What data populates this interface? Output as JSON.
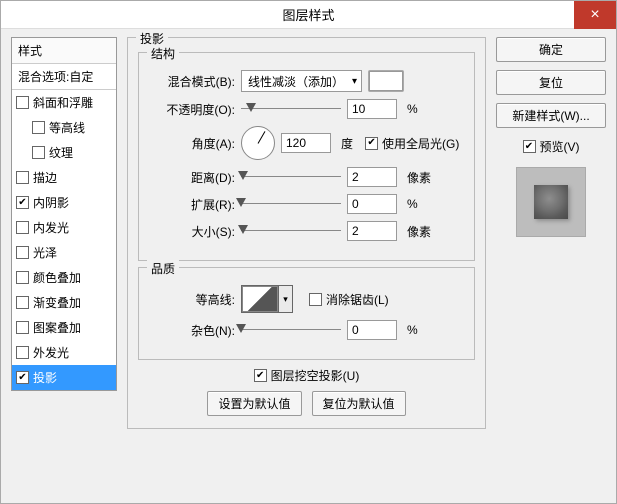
{
  "title": "图层样式",
  "left": {
    "header": "样式",
    "blending": "混合选项:自定",
    "items": [
      {
        "label": "斜面和浮雕",
        "checked": false,
        "indent": false
      },
      {
        "label": "等高线",
        "checked": false,
        "indent": true
      },
      {
        "label": "纹理",
        "checked": false,
        "indent": true
      },
      {
        "label": "描边",
        "checked": false,
        "indent": false
      },
      {
        "label": "内阴影",
        "checked": true,
        "indent": false
      },
      {
        "label": "内发光",
        "checked": false,
        "indent": false
      },
      {
        "label": "光泽",
        "checked": false,
        "indent": false
      },
      {
        "label": "颜色叠加",
        "checked": false,
        "indent": false
      },
      {
        "label": "渐变叠加",
        "checked": false,
        "indent": false
      },
      {
        "label": "图案叠加",
        "checked": false,
        "indent": false
      },
      {
        "label": "外发光",
        "checked": false,
        "indent": false
      },
      {
        "label": "投影",
        "checked": true,
        "indent": false,
        "selected": true
      }
    ]
  },
  "panel": {
    "title": "投影",
    "struct_title": "结构",
    "blend_mode_label": "混合模式(B):",
    "blend_mode_value": "线性减淡（添加）",
    "opacity_label": "不透明度(O):",
    "opacity_value": "10",
    "opacity_unit": "%",
    "angle_label": "角度(A):",
    "angle_value": "120",
    "angle_unit": "度",
    "global_light_label": "使用全局光(G)",
    "global_light_checked": true,
    "distance_label": "距离(D):",
    "distance_value": "2",
    "distance_unit": "像素",
    "spread_label": "扩展(R):",
    "spread_value": "0",
    "spread_unit": "%",
    "size_label": "大小(S):",
    "size_value": "2",
    "size_unit": "像素",
    "quality_title": "品质",
    "contour_label": "等高线:",
    "antialias_label": "消除锯齿(L)",
    "antialias_checked": false,
    "noise_label": "杂色(N):",
    "noise_value": "0",
    "noise_unit": "%",
    "knockout_label": "图层挖空投影(U)",
    "knockout_checked": true,
    "make_default": "设置为默认值",
    "reset_default": "复位为默认值"
  },
  "right": {
    "ok": "确定",
    "reset": "复位",
    "new_style": "新建样式(W)...",
    "preview_label": "预览(V)",
    "preview_checked": true
  }
}
